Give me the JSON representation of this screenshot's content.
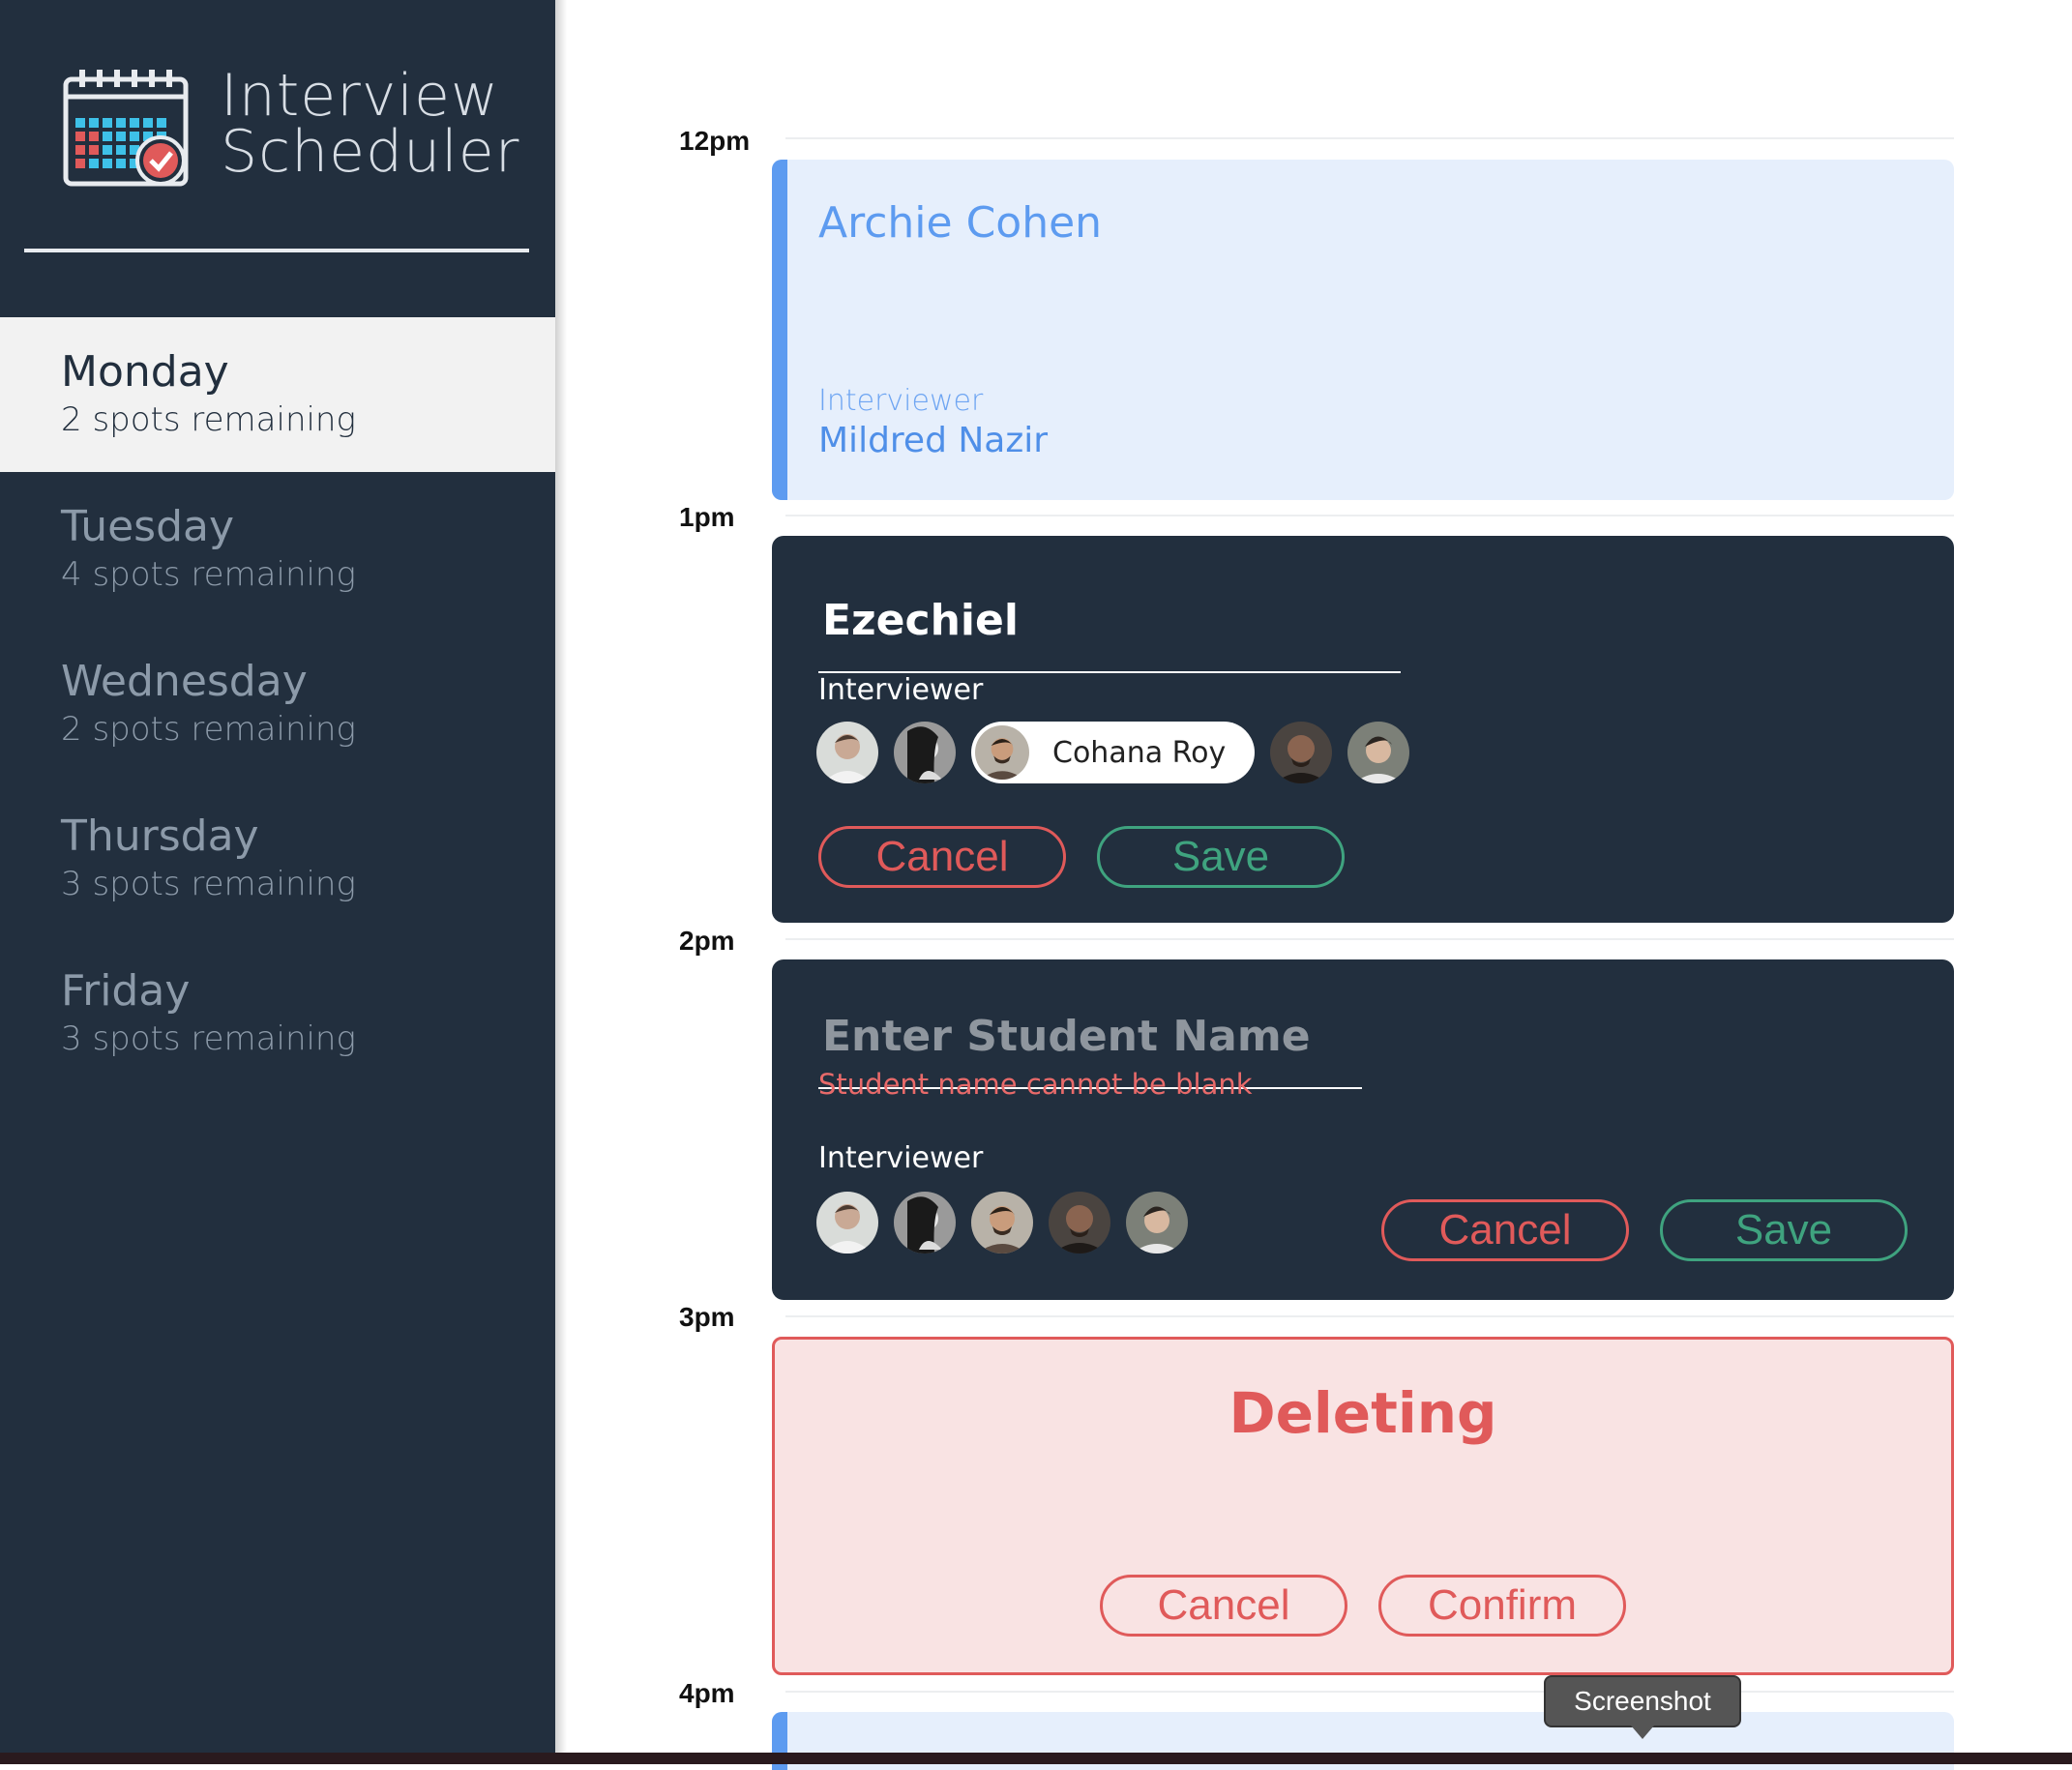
{
  "app": {
    "title_line1": "Interview",
    "title_line2": "Scheduler"
  },
  "days": [
    {
      "name": "Monday",
      "spots": "2 spots remaining",
      "selected": true
    },
    {
      "name": "Tuesday",
      "spots": "4 spots remaining",
      "selected": false
    },
    {
      "name": "Wednesday",
      "spots": "2 spots remaining",
      "selected": false
    },
    {
      "name": "Thursday",
      "spots": "3 spots remaining",
      "selected": false
    },
    {
      "name": "Friday",
      "spots": "3 spots remaining",
      "selected": false
    }
  ],
  "times": [
    "12pm",
    "1pm",
    "2pm",
    "3pm",
    "4pm"
  ],
  "appointment_show": {
    "student": "Archie Cohen",
    "interviewer_label": "Interviewer",
    "interviewer_name": "Mildred Nazir"
  },
  "form_edit": {
    "student_value": "Ezechiel",
    "interviewer_label": "Interviewer",
    "selected_interviewer": "Cohana Roy",
    "cancel_label": "Cancel",
    "save_label": "Save"
  },
  "form_new": {
    "student_placeholder": "Enter Student Name",
    "error": "Student name cannot be blank",
    "interviewer_label": "Interviewer",
    "cancel_label": "Cancel",
    "save_label": "Save"
  },
  "deleting": {
    "message": "Deleting",
    "cancel_label": "Cancel",
    "confirm_label": "Confirm"
  },
  "tooltip": {
    "text": "Screenshot"
  },
  "colors": {
    "sidebar_bg": "#222f3e",
    "show_bg": "#e6effc",
    "show_accent": "#5d9bf0",
    "danger": "#e05a5a",
    "confirm": "#3fa37f",
    "delete_bg": "#f9e3e3"
  }
}
